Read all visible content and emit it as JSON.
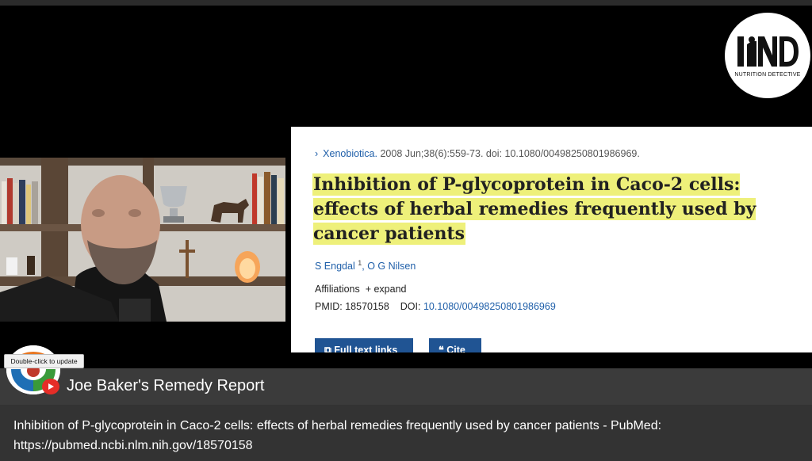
{
  "logo": {
    "letters": "ND",
    "subtitle": "NUTRITION DETECTIVE"
  },
  "pubmed": {
    "journal": "Xenobiotica.",
    "citation": "2008 Jun;38(6):559-73. doi: 10.1080/00498250801986969.",
    "title": "Inhibition of P-glycoprotein in Caco-2 cells: effects of herbal remedies frequently used by cancer patients",
    "authors": [
      {
        "name": "S Engdal",
        "sup": "1"
      },
      {
        "name": "O G Nilsen"
      }
    ],
    "affiliations_label": "Affiliations",
    "expand_label": "+ expand",
    "pmid_label": "PMID:",
    "pmid": "18570158",
    "doi_label": "DOI:",
    "doi": "10.1080/00498250801986969",
    "full_text_button": "Full text links",
    "cite_button": "Cite"
  },
  "tooltip": "Double-click to update",
  "channel_name": "Joe Baker's Remedy Report",
  "caption": {
    "line1": "Inhibition of P-glycoprotein in Caco-2 cells: effects of herbal remedies frequently used by cancer patients - PubMed:",
    "line2": "https://pubmed.ncbi.nlm.nih.gov/18570158"
  },
  "colors": {
    "highlight": "#eef07a",
    "link": "#1f5fa9",
    "button": "#205493",
    "youtube_red": "#e52d27"
  }
}
